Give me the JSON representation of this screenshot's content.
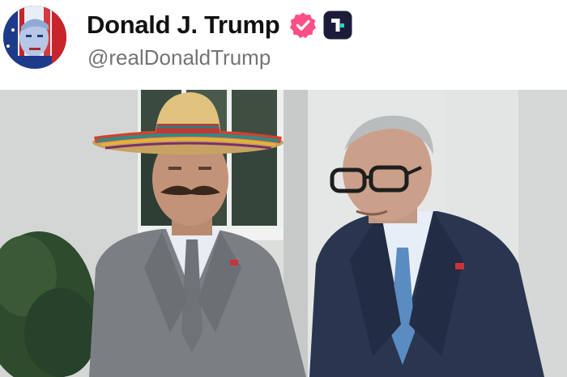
{
  "post": {
    "display_name": "Donald J. Trump",
    "handle": "@realDonaldTrump"
  },
  "icons": {
    "verified": "verified-badge-icon",
    "platform": "truth-social-icon"
  },
  "colors": {
    "verified_badge": "#ff4e86",
    "platform_badge": "#1c1c3a",
    "platform_accent": "#20d8c0",
    "name_text": "#111111",
    "handle_text": "#747474"
  }
}
